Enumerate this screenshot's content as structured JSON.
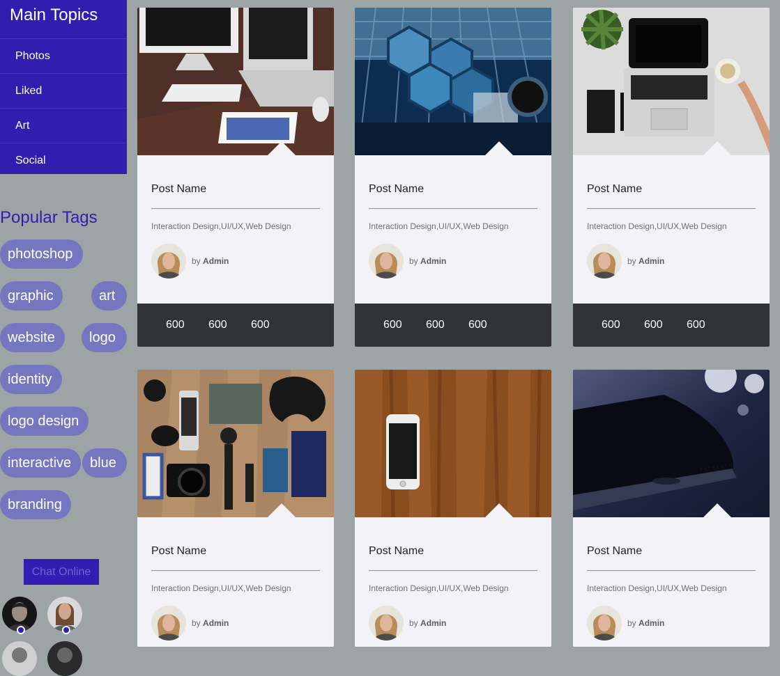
{
  "sidebar": {
    "title": "Main Topics",
    "items": [
      "Photos",
      "Liked",
      "Art",
      "Social"
    ],
    "popular_tags_title": "Popular Tags",
    "tags": [
      "photoshop",
      "graphic",
      "art",
      "website",
      "logo",
      "identity",
      "logo design",
      "interactive",
      "blue",
      "branding"
    ],
    "chat_button": "Chat Online"
  },
  "cards": [
    {
      "image_icon": "desk-workspace-photo",
      "post_name": "Post Name",
      "categories": "Interaction Design,UI/UX,Web Design",
      "author_prefix": "by",
      "author": "Admin",
      "stats": [
        "600",
        "600",
        "600"
      ]
    },
    {
      "image_icon": "telescope-mirror-photo",
      "post_name": "Post Name",
      "categories": "Interaction Design,UI/UX,Web Design",
      "author_prefix": "by",
      "author": "Admin",
      "stats": [
        "600",
        "600",
        "600"
      ]
    },
    {
      "image_icon": "laptop-plant-photo",
      "post_name": "Post Name",
      "categories": "Interaction Design,UI/UX,Web Design",
      "author_prefix": "by",
      "author": "Admin",
      "stats": [
        "600",
        "600",
        "600"
      ]
    },
    {
      "image_icon": "gadgets-flatlay-photo",
      "post_name": "Post Name",
      "categories": "Interaction Design,UI/UX,Web Design",
      "author_prefix": "by",
      "author": "Admin",
      "stats": []
    },
    {
      "image_icon": "phone-on-wood-photo",
      "post_name": "Post Name",
      "categories": "Interaction Design,UI/UX,Web Design",
      "author_prefix": "by",
      "author": "Admin",
      "stats": []
    },
    {
      "image_icon": "dark-phone-photo",
      "post_name": "Post Name",
      "categories": "Interaction Design,UI/UX,Web Design",
      "author_prefix": "by",
      "author": "Admin",
      "stats": []
    }
  ],
  "colors": {
    "background": "#9ca4a5",
    "sidebar": "#311eb1",
    "tag": "#7477bf",
    "card": "#f3f2f6",
    "footer": "#303437"
  }
}
